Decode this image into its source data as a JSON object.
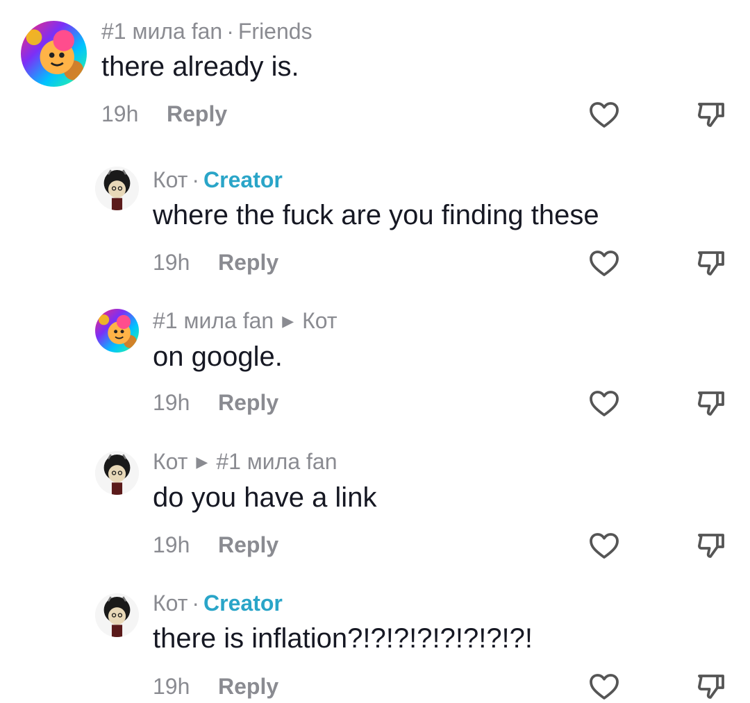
{
  "comments": [
    {
      "username": "#1 мила fan",
      "separator": "·",
      "tag": "Friends",
      "text": "there already is.",
      "time": "19h",
      "reply_label": "Reply",
      "avatar": "colorful-cartoon-avatar"
    },
    {
      "username": "Кот",
      "separator": "·",
      "tag": "Creator",
      "text": "where the fuck are you finding these",
      "time": "19h",
      "reply_label": "Reply",
      "avatar": "curly-hair-drawing-avatar"
    },
    {
      "username": "#1 мила fan",
      "reply_to": "Кот",
      "text": "on google.",
      "time": "19h",
      "reply_label": "Reply",
      "avatar": "colorful-cartoon-avatar"
    },
    {
      "username": "Кот",
      "reply_to": "#1 мила fan",
      "text": "do you have a link",
      "time": "19h",
      "reply_label": "Reply",
      "avatar": "curly-hair-drawing-avatar"
    },
    {
      "username": "Кот",
      "separator": "·",
      "tag": "Creator",
      "text": "there is inflation?!?!?!?!?!?!?!?!",
      "time": "19h",
      "reply_label": "Reply",
      "avatar": "curly-hair-drawing-avatar"
    }
  ],
  "icons": {
    "like": "heart-outline-icon",
    "dislike": "thumbs-down-outline-icon",
    "reply_arrow": "triangle-right-icon"
  },
  "colors": {
    "creator_tag": "#2aa5c8",
    "secondary_text": "#8a8b91",
    "primary_text": "#161823",
    "icon": "#555555"
  }
}
